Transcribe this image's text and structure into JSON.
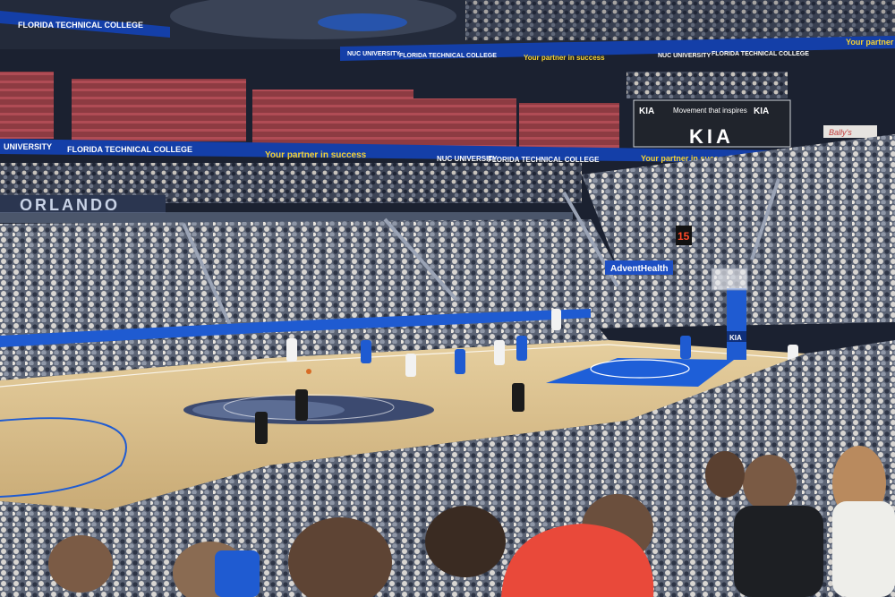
{
  "ribbon_upper": {
    "left_segment": "FLORIDA TECHNICAL COLLEGE",
    "segment_1": "NUC UNIVERSITY",
    "segment_2": "FLORIDA TECHNICAL COLLEGE",
    "segment_3": "Your partner in success",
    "segment_4": "NUC UNIVERSITY",
    "segment_5": "FLORIDA TECHNICAL COLLEGE",
    "segment_6": "Your partner"
  },
  "ribbon_lower": {
    "segment_1": "UNIVERSITY",
    "segment_2": "FLORIDA TECHNICAL COLLEGE",
    "segment_3": "Your partner in success",
    "segment_4": "NUC UNIVERSITY",
    "segment_5": "FLORIDA TECHNICAL COLLEGE",
    "segment_6": "Your partner in success"
  },
  "kia_sign": {
    "brand_left": "KIA",
    "slogan": "Movement that inspires",
    "brand_right": "KIA",
    "big_logo": "KIA"
  },
  "orlando_wall": "ORLANDO",
  "advent_sign": "AdventHealth",
  "ballys_sign": "Bally's",
  "shot_clock": "15",
  "stanchion_brand": "KIA",
  "colors": {
    "arena_dark": "#1b2130",
    "seat_red": "#a3434a",
    "ribbon_blue": "#143fa8",
    "ribbon_yellow": "#f5d232",
    "court_wood": "#d9bf8f",
    "paint_blue": "#1e5fd8",
    "magic_blue": "#1f5bd1",
    "crowd_mix": "#6b7383"
  }
}
